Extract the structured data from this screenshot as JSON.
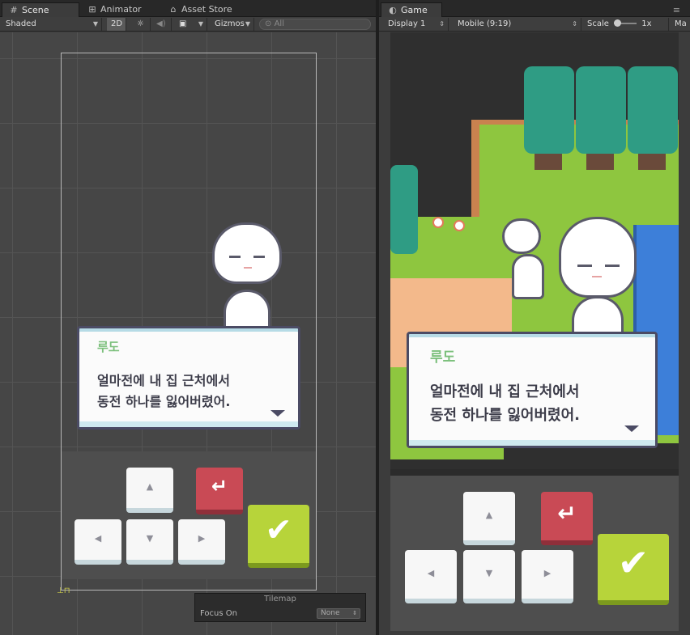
{
  "scene_panel": {
    "tabs": [
      {
        "label": "Scene",
        "icon": "grid-icon",
        "active": true
      },
      {
        "label": "Animator",
        "icon": "animator-icon",
        "active": false
      },
      {
        "label": "Asset Store",
        "icon": "store-icon",
        "active": false
      }
    ],
    "toolbar": {
      "shading_mode": "Shaded",
      "mode_2d": "2D",
      "gizmos_label": "Gizmos",
      "search_placeholder": "All"
    },
    "tilemap_overlay": {
      "title": "Tilemap",
      "focus_label": "Focus On",
      "focus_value": "None"
    }
  },
  "game_panel": {
    "tab": {
      "label": "Game",
      "icon": "game-icon"
    },
    "toolbar": {
      "display": "Display 1",
      "aspect": "Mobile (9:19)",
      "scale_label": "Scale",
      "scale_value": "1x",
      "maximize_label": "Ma"
    }
  },
  "dialogue": {
    "speaker": "루도",
    "line1": "얼마전에 내 집 근처에서",
    "line2": "동전 하나를 잃어버렸어."
  },
  "controls": {
    "up_icon": "arrow-up-icon",
    "down_icon": "arrow-down-icon",
    "left_icon": "arrow-left-icon",
    "right_icon": "arrow-right-icon",
    "back_icon": "return-icon",
    "confirm_icon": "checkmark-icon"
  },
  "colors": {
    "editor_bg": "#3c3c3c",
    "grass": "#8ec63f",
    "water": "#3d7fd9",
    "tree": "#2f9c84",
    "path": "#f3b98b",
    "speaker": "#7cc07c",
    "back_button": "#c94a55",
    "confirm_button": "#b7d43a"
  }
}
